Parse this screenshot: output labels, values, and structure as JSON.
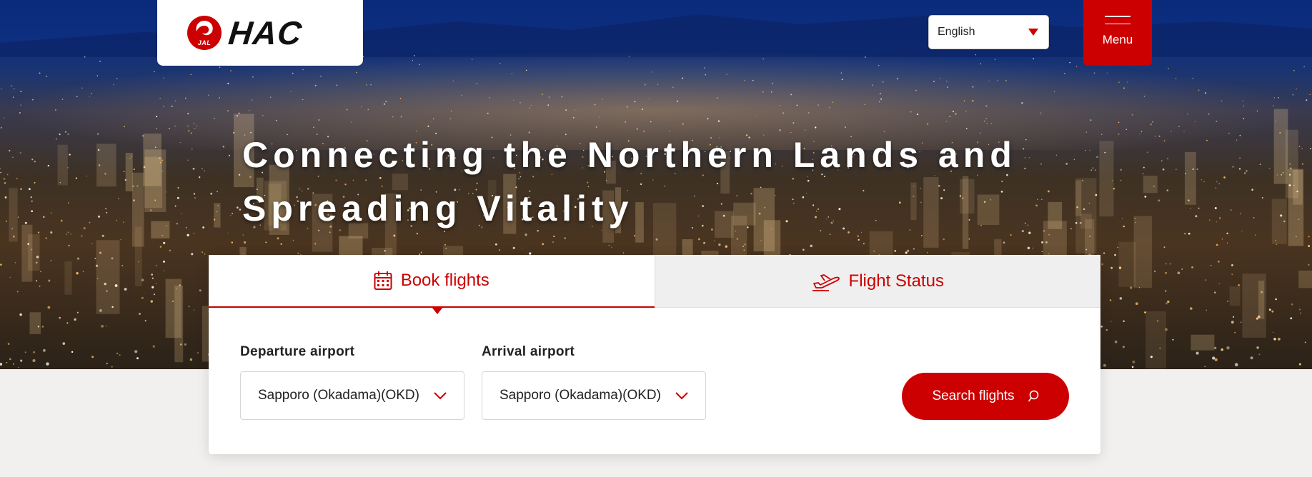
{
  "header": {
    "logo_badge": "JAL",
    "logo_text": "HAC",
    "language": "English",
    "menu_label": "Menu"
  },
  "hero": {
    "headline_line1": "Connecting the Northern Lands and",
    "headline_line2": "Spreading Vitality"
  },
  "booking": {
    "tabs": [
      {
        "label": "Book flights",
        "icon": "calendar-icon",
        "active": true
      },
      {
        "label": "Flight Status",
        "icon": "airplane-departure-icon",
        "active": false
      }
    ],
    "departure_label": "Departure airport",
    "departure_value": "Sapporo (Okadama)(OKD)",
    "arrival_label": "Arrival airport",
    "arrival_value": "Sapporo (Okadama)(OKD)",
    "search_label": "Search flights"
  },
  "colors": {
    "brand_red": "#cc0000",
    "inactive_tab": "#efefef",
    "page_bg": "#f1f0ef"
  }
}
